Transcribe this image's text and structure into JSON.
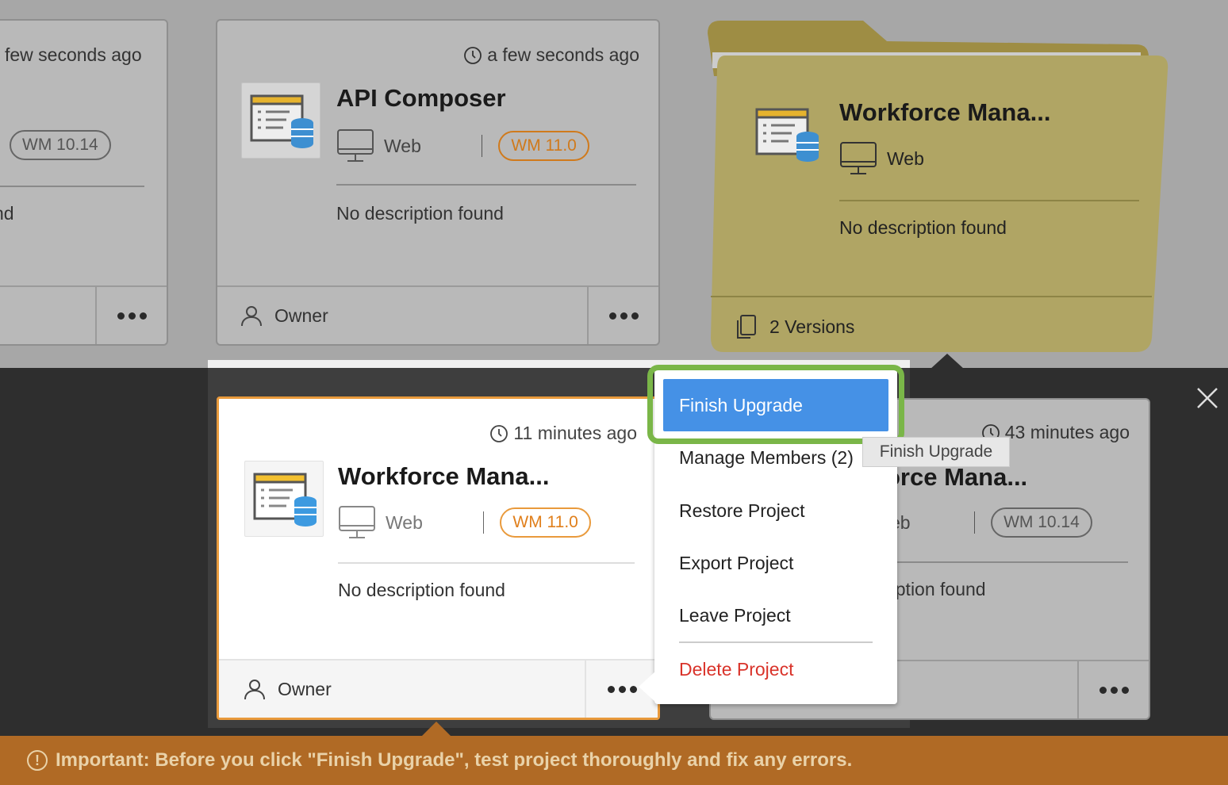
{
  "cards": {
    "left": {
      "time": "few seconds ago",
      "version": "WM 10.14",
      "desc": "nd"
    },
    "api": {
      "time": "a few seconds ago",
      "title": "API Composer",
      "platform": "Web",
      "version": "WM 11.0",
      "desc": "No description found",
      "owner": "Owner"
    },
    "folder": {
      "title": "Workforce Mana...",
      "platform": "Web",
      "desc": "No description found",
      "versions": "2 Versions"
    },
    "selected": {
      "time": "11 minutes ago",
      "title": "Workforce Mana...",
      "platform": "Web",
      "version": "WM 11.0",
      "desc": "No description found",
      "owner": "Owner"
    },
    "right": {
      "time": "43 minutes ago",
      "title": "orce Mana...",
      "platform": "eb",
      "version": "WM 10.14",
      "desc": "ription found"
    }
  },
  "menu": {
    "finish_upgrade": "Finish Upgrade",
    "manage_members": "Manage Members (2)",
    "restore_project": "Restore Project",
    "export_project": "Export Project",
    "leave_project": "Leave Project",
    "delete_project": "Delete Project"
  },
  "tooltip": "Finish Upgrade",
  "banner": "Important: Before you click \"Finish Upgrade\", test project thoroughly and fix any errors.",
  "colors": {
    "accent_orange": "#d07a1c",
    "primary_blue": "#4591e6",
    "highlight_green": "#7ab648",
    "folder_gold": "#b0a564",
    "danger_red": "#d9332a",
    "banner_brown": "#b06a25"
  }
}
